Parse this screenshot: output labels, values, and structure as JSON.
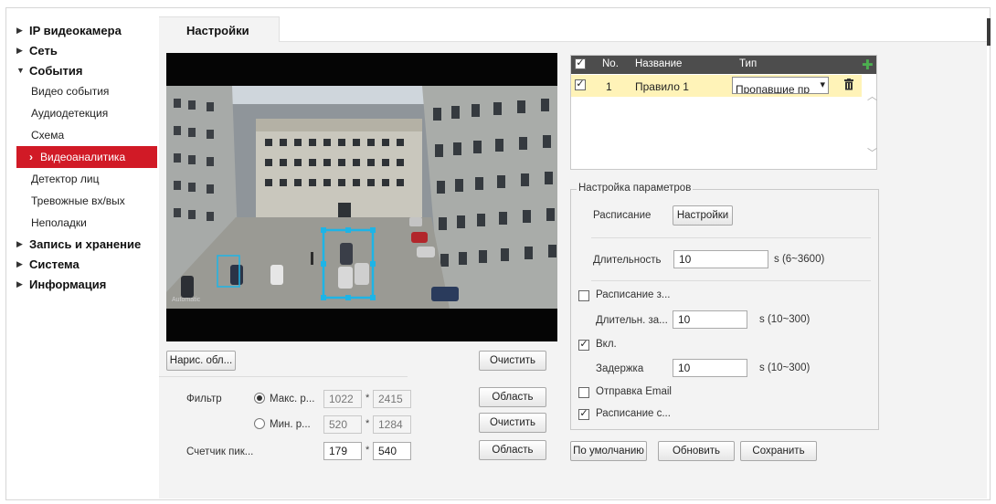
{
  "sidebar": {
    "items": [
      {
        "label": "IP видеокамера",
        "expanded": false
      },
      {
        "label": "Сеть",
        "expanded": false
      },
      {
        "label": "События",
        "expanded": true
      }
    ],
    "sub_items": [
      {
        "label": "Видео события"
      },
      {
        "label": "Аудиодетекция"
      },
      {
        "label": "Схема"
      },
      {
        "label": "Видеоаналитика",
        "active": true
      },
      {
        "label": "Детектор лиц"
      },
      {
        "label": "Тревожные вх/вых"
      },
      {
        "label": "Неполадки"
      }
    ],
    "bottom_items": [
      {
        "label": "Запись и хранение"
      },
      {
        "label": "Система"
      },
      {
        "label": "Информация"
      }
    ]
  },
  "tab": {
    "label": "Настройки"
  },
  "video": {
    "timestamp": "Automatic"
  },
  "controls": {
    "draw_area_label": "Нарис. обл...",
    "clear_label": "Очистить",
    "filter_label": "Фильтр",
    "max_label": "Макс. р...",
    "min_label": "Мин. р...",
    "max_w": "1022",
    "max_h": "2415",
    "min_w": "520",
    "min_h": "1284",
    "area_label": "Область",
    "clear2_label": "Очистить",
    "pixel_counter_label": "Счетчик пик...",
    "pix_w": "179",
    "pix_h": "540",
    "area2_label": "Область",
    "times": "*"
  },
  "rules": {
    "headers": {
      "no": "No.",
      "name": "Название",
      "type": "Тип"
    },
    "rows": [
      {
        "no": "1",
        "name": "Правило 1",
        "type": "Пропавшие пр"
      }
    ]
  },
  "params": {
    "legend": "Настройка параметров",
    "schedule_label": "Расписание",
    "settings_button": "Настройки",
    "duration_label": "Длительность",
    "duration_value": "10",
    "duration_range": "s (6~3600)",
    "schedule_z_label": "Расписание з...",
    "duration2_label": "Длительн. за...",
    "duration2_value": "10",
    "duration2_range": "s (10~300)",
    "enable_label": "Вкл.",
    "delay_label": "Задержка",
    "delay_value": "10",
    "delay_range": "s (10~300)",
    "email_label": "Отправка Email",
    "schedule_c_label": "Расписание с..."
  },
  "footer": {
    "default_label": "По умолчанию",
    "refresh_label": "Обновить",
    "save_label": "Сохранить"
  },
  "colors": {
    "active_nav": "#d11a26",
    "selected_row": "#fff3b8",
    "detect_box": "#1eb4e6"
  }
}
